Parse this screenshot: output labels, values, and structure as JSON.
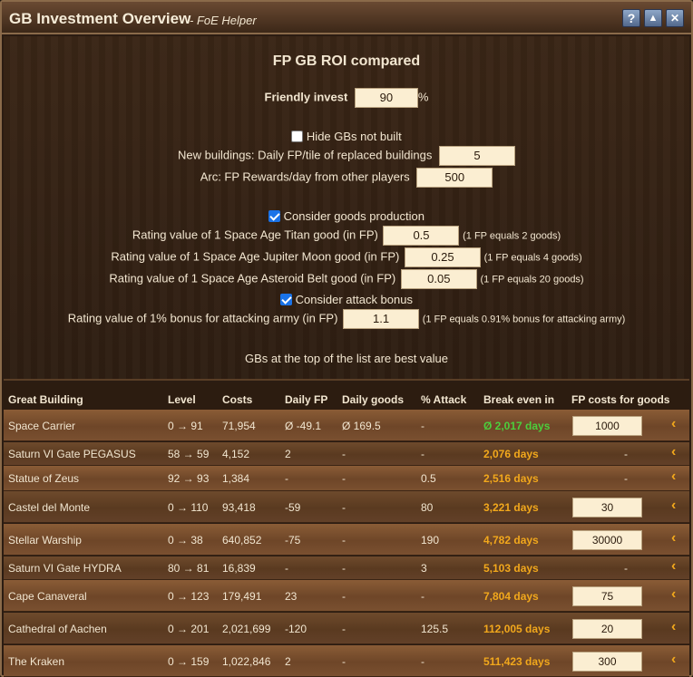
{
  "window": {
    "title": "GB Investment Overview",
    "subtitle": "- FoE Helper",
    "buttons": {
      "help": "?",
      "minimize": "▲",
      "close": "✕"
    }
  },
  "settings": {
    "heading": "FP GB ROI compared",
    "friendly_invest_label": "Friendly invest",
    "friendly_invest_value": "90",
    "friendly_invest_unit": "%",
    "hide_gbs_label": "Hide GBs not built",
    "new_buildings_label": "New buildings: Daily FP/tile of replaced buildings",
    "new_buildings_value": "5",
    "arc_label": "Arc: FP Rewards/day from other players",
    "arc_value": "500",
    "consider_goods_label": "Consider goods production",
    "titan_label": "Rating value of 1 Space Age Titan good (in FP)",
    "titan_value": "0.5",
    "titan_note": "(1 FP equals 2 goods)",
    "jupiter_label": "Rating value of 1 Space Age Jupiter Moon good (in FP)",
    "jupiter_value": "0.25",
    "jupiter_note": "(1 FP equals 4 goods)",
    "asteroid_label": "Rating value of 1 Space Age Asteroid Belt good (in FP)",
    "asteroid_value": "0.05",
    "asteroid_note": "(1 FP equals 20 goods)",
    "consider_attack_label": "Consider attack bonus",
    "attack_label": "Rating value of 1% bonus for attacking army (in FP)",
    "attack_value": "1.1",
    "attack_note": "(1 FP equals 0.91% bonus for attacking army)",
    "best_value_note": "GBs at the top of the list are best value"
  },
  "table": {
    "headers": {
      "building": "Great Building",
      "level": "Level",
      "costs": "Costs",
      "daily_fp": "Daily FP",
      "daily_goods": "Daily goods",
      "attack": "% Attack",
      "break_even": "Break even in",
      "fp_costs": "FP costs for goods"
    },
    "rows": [
      {
        "building": "Space Carrier",
        "level": "0 → 91",
        "costs": "71,954",
        "daily_fp": "Ø -49.1",
        "daily_goods": "Ø 169.5",
        "attack": "-",
        "break_even": "Ø 2,017 days",
        "fp_costs": "1000"
      },
      {
        "building": "Saturn VI Gate PEGASUS",
        "level": "58 → 59",
        "costs": "4,152",
        "daily_fp": "2",
        "daily_goods": "-",
        "attack": "-",
        "break_even": "2,076 days",
        "fp_costs": "-"
      },
      {
        "building": "Statue of Zeus",
        "level": "92 → 93",
        "costs": "1,384",
        "daily_fp": "-",
        "daily_goods": "-",
        "attack": "0.5",
        "break_even": "2,516 days",
        "fp_costs": "-"
      },
      {
        "building": "Castel del Monte",
        "level": "0 → 110",
        "costs": "93,418",
        "daily_fp": "-59",
        "daily_goods": "-",
        "attack": "80",
        "break_even": "3,221 days",
        "fp_costs": "30"
      },
      {
        "building": "Stellar Warship",
        "level": "0 → 38",
        "costs": "640,852",
        "daily_fp": "-75",
        "daily_goods": "-",
        "attack": "190",
        "break_even": "4,782 days",
        "fp_costs": "30000"
      },
      {
        "building": "Saturn VI Gate HYDRA",
        "level": "80 → 81",
        "costs": "16,839",
        "daily_fp": "-",
        "daily_goods": "-",
        "attack": "3",
        "break_even": "5,103 days",
        "fp_costs": "-"
      },
      {
        "building": "Cape Canaveral",
        "level": "0 → 123",
        "costs": "179,491",
        "daily_fp": "23",
        "daily_goods": "-",
        "attack": "-",
        "break_even": "7,804 days",
        "fp_costs": "75"
      },
      {
        "building": "Cathedral of Aachen",
        "level": "0 → 201",
        "costs": "2,021,699",
        "daily_fp": "-120",
        "daily_goods": "-",
        "attack": "125.5",
        "break_even": "112,005 days",
        "fp_costs": "20"
      },
      {
        "building": "The Kraken",
        "level": "0 → 159",
        "costs": "1,022,846",
        "daily_fp": "2",
        "daily_goods": "-",
        "attack": "-",
        "break_even": "511,423 days",
        "fp_costs": "300"
      }
    ]
  },
  "colors": {
    "break_even_good": "#4ccf3c",
    "break_even": "#f2a81c"
  }
}
